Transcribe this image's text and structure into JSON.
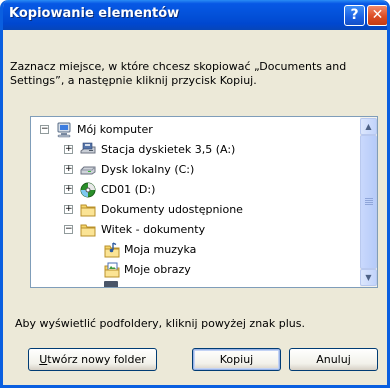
{
  "dialog": {
    "title": "Kopiowanie elementów",
    "instruction": "Zaznacz miejsce, w które chcesz skopiować „Documents and Settings”, a następnie kliknij przycisk Kopiuj.",
    "hint": "Aby wyświetlić podfoldery, kliknij powyżej znak plus."
  },
  "titlebar": {
    "help_glyph": "?",
    "close_glyph": "✕"
  },
  "tree": {
    "items": [
      {
        "label": "Mój komputer",
        "icon": "computer-icon",
        "expander": "−"
      },
      {
        "label": "Stacja dyskietek 3,5 (A:)",
        "icon": "floppy-drive-icon",
        "expander": "+"
      },
      {
        "label": "Dysk lokalny (C:)",
        "icon": "hard-drive-icon",
        "expander": "+"
      },
      {
        "label": "CD01 (D:)",
        "icon": "cd-drive-icon",
        "expander": "+"
      },
      {
        "label": "Dokumenty udostępnione",
        "icon": "folder-icon",
        "expander": "+"
      },
      {
        "label": "Witek - dokumenty",
        "icon": "folder-icon",
        "expander": "−"
      },
      {
        "label": "Moja muzyka",
        "icon": "music-folder-icon",
        "expander": ""
      },
      {
        "label": "Moje obrazy",
        "icon": "pictures-folder-icon",
        "expander": ""
      }
    ]
  },
  "scrollbar": {
    "up_glyph": "▲",
    "down_glyph": "▼"
  },
  "buttons": {
    "new_folder_accel": "U",
    "new_folder_rest": "twórz nowy folder",
    "copy_label": "Kopiuj",
    "cancel_label": "Anuluj"
  }
}
